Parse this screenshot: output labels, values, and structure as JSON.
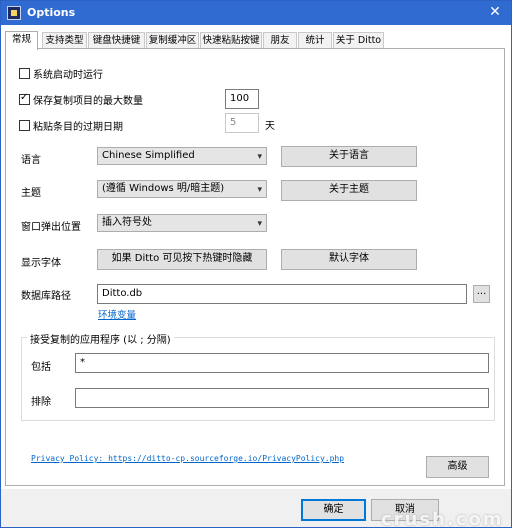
{
  "window": {
    "title": "Options",
    "close_glyph": "✕"
  },
  "tabs": [
    {
      "label": "常规"
    },
    {
      "label": "支持类型"
    },
    {
      "label": "键盘快捷键"
    },
    {
      "label": "复制缓冲区"
    },
    {
      "label": "快速粘贴按键"
    },
    {
      "label": "朋友"
    },
    {
      "label": "统计"
    },
    {
      "label": "关于 Ditto"
    }
  ],
  "general": {
    "start_on_boot": {
      "label": "系统启动时运行",
      "checked": false
    },
    "max_items": {
      "label": "保存复制项目的最大数量",
      "checked": true,
      "value": "100"
    },
    "expire": {
      "label": "粘贴条目的过期日期",
      "checked": false,
      "value": "5",
      "unit": "天"
    },
    "language": {
      "label": "语言",
      "value": "Chinese Simplified",
      "button": "关于语言"
    },
    "theme": {
      "label": "主题",
      "value": "(遵循 Windows 明/暗主题)",
      "button": "关于主题"
    },
    "popup_position": {
      "label": "窗口弹出位置",
      "value": "插入符号处"
    },
    "display_font": {
      "label": "显示字体",
      "font_button": "如果 Ditto 可见按下热键时隐藏",
      "default_button": "默认字体"
    },
    "db_path": {
      "label": "数据库路径",
      "value": "Ditto.db",
      "browse": "...",
      "link": "环境变量"
    }
  },
  "accept_apps": {
    "title": "接受复制的应用程序 (以 ; 分隔)",
    "include_label": "包括",
    "include_value": "*",
    "exclude_label": "排除",
    "exclude_value": ""
  },
  "footer": {
    "privacy_link": "Privacy Policy: https://ditto-cp.sourceforge.io/PrivacyPolicy.php",
    "advanced_button": "高级",
    "ok_button": "确定",
    "cancel_button": "取消",
    "watermark": "crush.com"
  },
  "colors": {
    "titlebar": "#2f6bd0",
    "link": "#0066cc",
    "accent": "#0078d7"
  }
}
